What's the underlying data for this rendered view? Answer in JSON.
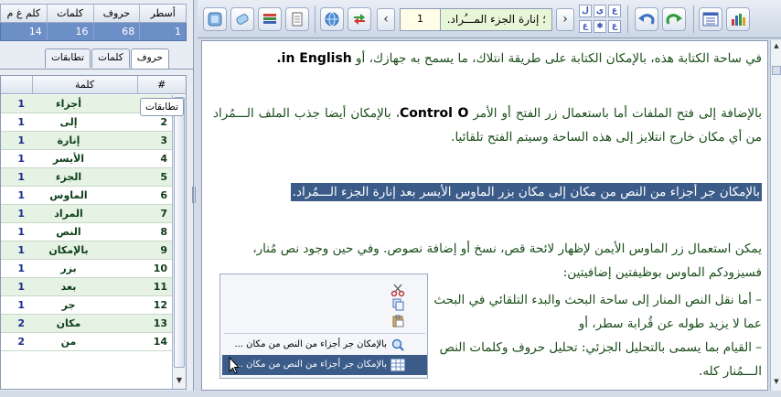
{
  "stats": {
    "headers": [
      "كلم غ م",
      "كلمات",
      "حروف",
      "أسطر"
    ],
    "values": [
      "14",
      "16",
      "68",
      "1"
    ]
  },
  "tabs": {
    "top": [
      "تطابقات",
      "كلمات",
      "حروف"
    ],
    "floating": "تطابقات"
  },
  "grid": {
    "headers": [
      "",
      "كلمة",
      "#"
    ],
    "rows": [
      {
        "num": "1",
        "word": "أجزاء",
        "count": "1"
      },
      {
        "num": "2",
        "word": "إلى",
        "count": "1"
      },
      {
        "num": "3",
        "word": "إنارة",
        "count": "1"
      },
      {
        "num": "4",
        "word": "الأيسر",
        "count": "1"
      },
      {
        "num": "5",
        "word": "الجزء",
        "count": "1"
      },
      {
        "num": "6",
        "word": "الماوس",
        "count": "1"
      },
      {
        "num": "7",
        "word": "المراد",
        "count": "1"
      },
      {
        "num": "8",
        "word": "النص",
        "count": "1"
      },
      {
        "num": "9",
        "word": "بالإمكان",
        "count": "1"
      },
      {
        "num": "10",
        "word": "بزر",
        "count": "1"
      },
      {
        "num": "11",
        "word": "بعد",
        "count": "1"
      },
      {
        "num": "12",
        "word": "جر",
        "count": "1"
      },
      {
        "num": "13",
        "word": "مكان",
        "count": "2"
      },
      {
        "num": "14",
        "word": "من",
        "count": "2"
      }
    ]
  },
  "toolbar": {
    "page_number": "1",
    "page_title": "؛ إنارة الجزء المـــُراد.",
    "small_buttons": [
      "ل",
      "ي",
      "ع",
      "ع",
      "ل",
      "ع"
    ]
  },
  "document": {
    "p1_text": "في ساحة الكتابة هذه، بالإمكان الكتابة على طريقة انتلاك، ما يسمح به جهازك، أو ",
    "p1_en": "in English.",
    "p2_a": "بالإضافة إلى فتح الملفات أما باستعمال زر الفتح أو الأمر ",
    "p2_en": "Control O",
    "p2_b": "، بالإمكان أيضا جذب الملف الـــمُراد من أي مكان خارج انتلايز إلى هذه الساحة وسيتم الفتح تلقائيا.",
    "p3_highlight": "بالإمكان جر أجزاء من النص من مكان إلى مكان بزر الماوس الأيسر بعد إنارة الجزء الـــمُراد.",
    "p4_line1": "يمكن استعمال زر الماوس الأيمن لإظهار لائحة قص، نسخ أو إضافة نصوص. وفي حين وجود نص مُنار،",
    "p4_line2": "فسيزودكم الماوس بوظيفتين إضافيتين:",
    "bullet1": "– أما نقل النص المنار إلى ساحة البحث والبدء التلقائي في البحث عما لا يزيد طوله عن قُرابة سطر، أو",
    "bullet2": "– القيام بما يسمى بالتحليل الجزئي: تحليل حروف وكلمات النص الـــمُنار كله."
  },
  "context_menu": {
    "item_search": "بالإمكان جر أجزاء من النص من مكان ...",
    "item_analyze": "بالإمكان جر أجزاء من النص من مكان ..."
  },
  "colors": {
    "highlight": "#3b5b89",
    "text_green": "#1a4d1a",
    "stats_blue": "#6d8fc7",
    "row_green": "#e6f2e4"
  }
}
